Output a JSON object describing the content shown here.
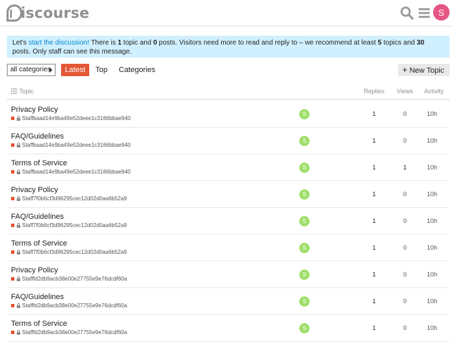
{
  "header": {
    "logo_text": "iscourse",
    "avatar_letter": "S",
    "avatar_color": "#e45683"
  },
  "notice": {
    "prefix": "Let's ",
    "link": "start the discussion!",
    "t1": " There is ",
    "topics_count": "1",
    "t2": " topic and ",
    "posts_count": "0",
    "t3": " posts. Visitors need more to read and reply to – we recommend at least ",
    "rec_topics": "5",
    "t4": " topics and ",
    "rec_posts": "30",
    "t5": " posts. Only staff can see this message."
  },
  "nav": {
    "category_dropdown": "all categories",
    "latest": "Latest",
    "top": "Top",
    "categories": "Categories",
    "new_topic": "New Topic"
  },
  "table": {
    "headers": {
      "topic": "Topic",
      "replies": "Replies",
      "views": "Views",
      "activity": "Activity"
    },
    "rows": [
      {
        "title": "Privacy Policy",
        "category": "Staffbaad14e9ba49e52deee1c3166bbae940",
        "poster": "S",
        "replies": "1",
        "views": "0",
        "activity": "10h"
      },
      {
        "title": "FAQ/Guidelines",
        "category": "Staffbaad14e9ba49e52deee1c3166bbae940",
        "poster": "S",
        "replies": "1",
        "views": "0",
        "activity": "10h"
      },
      {
        "title": "Terms of Service",
        "category": "Staffbaad14e9ba49e52deee1c3166bbae940",
        "poster": "S",
        "replies": "1",
        "views": "1",
        "activity": "10h"
      },
      {
        "title": "Privacy Policy",
        "category": "Staff7f0b6cf3d96295cec12d02d0aa6b52a9",
        "poster": "S",
        "replies": "1",
        "views": "0",
        "activity": "10h"
      },
      {
        "title": "FAQ/Guidelines",
        "category": "Staff7f0b6cf3d96295cec12d02d0aa6b52a9",
        "poster": "S",
        "replies": "1",
        "views": "0",
        "activity": "10h"
      },
      {
        "title": "Terms of Service",
        "category": "Staff7f0b6cf3d96295cec12d02d0aa6b52a9",
        "poster": "S",
        "replies": "1",
        "views": "0",
        "activity": "10h"
      },
      {
        "title": "Privacy Policy",
        "category": "Stafffd2db9acb38e00e27755e9e76dcdf60a",
        "poster": "S",
        "replies": "1",
        "views": "0",
        "activity": "10h"
      },
      {
        "title": "FAQ/Guidelines",
        "category": "Stafffd2db9acb38e00e27755e9e76dcdf60a",
        "poster": "S",
        "replies": "1",
        "views": "0",
        "activity": "10h"
      },
      {
        "title": "Terms of Service",
        "category": "Stafffd2db9acb38e00e27755e9e76dcdf60a",
        "poster": "S",
        "replies": "1",
        "views": "0",
        "activity": "10h"
      }
    ]
  },
  "colors": {
    "accent": "#e45735",
    "link": "#0088cc",
    "notice_bg": "#d1f0ff",
    "poster_avatar": "#9fdf6a"
  },
  "icons": [
    "discourse-logo-icon",
    "search-icon",
    "hamburger-menu-icon",
    "caret-right-icon",
    "plus-icon",
    "list-icon",
    "lock-icon"
  ]
}
